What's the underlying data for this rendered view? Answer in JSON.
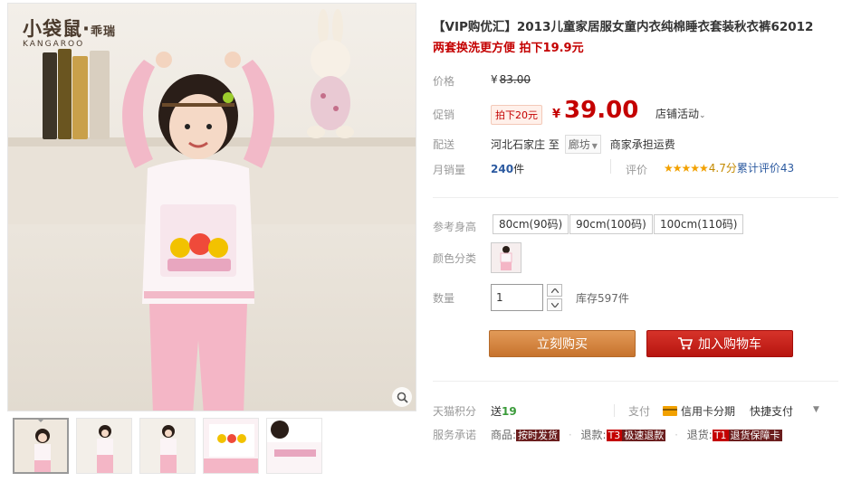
{
  "brand": {
    "name_cn": "小袋鼠·",
    "name_cn_small": "乖瑞",
    "name_en": "KANGAROO"
  },
  "product": {
    "title": "【VIP购优汇】2013儿童家居服女童内衣纯棉睡衣套装秋衣裤62012",
    "subtitle": "两套换洗更方便 拍下19.9元"
  },
  "price": {
    "label": "价格",
    "currency": "¥",
    "original": "83.00",
    "promo_label": "促销",
    "promo_tag": "拍下20元",
    "current": "39.00",
    "shop_event": "店铺活动"
  },
  "delivery": {
    "label": "配送",
    "from": "河北石家庄",
    "to_word": "至",
    "dest": "廊坊",
    "freight": "商家承担运费"
  },
  "sales": {
    "label": "月销量",
    "count": "240",
    "unit": "件",
    "rating_label": "评价",
    "stars": "★★★★★",
    "score": "4.7分",
    "review_text": "累计评价43"
  },
  "options": {
    "height_label": "参考身高",
    "heights": [
      "80cm(90码)",
      "90cm(100码)",
      "100cm(110码)"
    ],
    "color_label": "颜色分类"
  },
  "quantity": {
    "label": "数量",
    "value": "1",
    "stock": "库存597件"
  },
  "buttons": {
    "buy": "立刻购买",
    "cart": "加入购物车"
  },
  "footer": {
    "points_label": "天猫积分",
    "points_prefix": "送",
    "points_value": "19",
    "pay_label": "支付",
    "pay_card": "信用卡分期",
    "pay_fast": "快捷支付",
    "promise_label": "服务承诺",
    "promise_goods": "商品:",
    "promise_goods_tag": "按时发货",
    "promise_refund": "退款:",
    "promise_refund_pre": "T3",
    "promise_refund_tag": "极速退款",
    "promise_return": "退货:",
    "promise_return_pre": "T1",
    "promise_return_tag": "退货保障卡"
  },
  "colors": {
    "accent_red": "#c40000",
    "buy_orange": "#c7732d",
    "cart_red": "#b7150f"
  }
}
